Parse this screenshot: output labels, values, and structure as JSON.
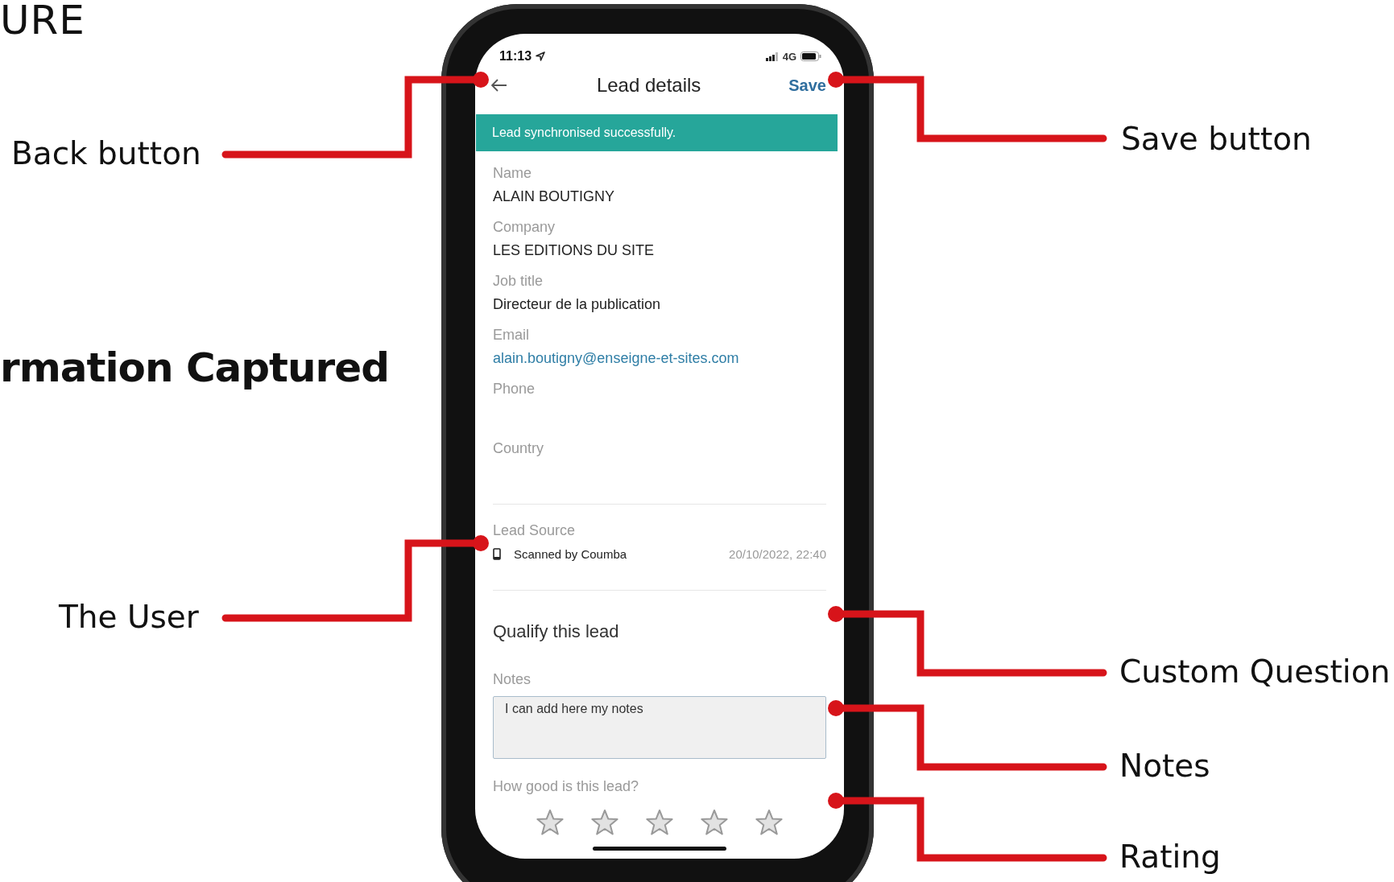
{
  "slide": {
    "heading_top": "URE",
    "heading_middle": "rmation Captured"
  },
  "annotations": [
    {
      "text": "Back button"
    },
    {
      "text": "Save button"
    },
    {
      "text": "The User"
    },
    {
      "text": "Custom Question"
    },
    {
      "text": "Notes"
    },
    {
      "text": "Rating"
    }
  ],
  "phone": {
    "status_bar": {
      "time": "11:13",
      "network": "4G"
    },
    "header": {
      "title": "Lead details",
      "save": "Save"
    },
    "banner": "Lead synchronised successfully.",
    "fields": [
      {
        "label": "Name",
        "value": "ALAIN BOUTIGNY",
        "kind": "text"
      },
      {
        "label": "Company",
        "value": "LES EDITIONS DU SITE",
        "kind": "text"
      },
      {
        "label": "Job title",
        "value": "Directeur de la publication",
        "kind": "text"
      },
      {
        "label": "Email",
        "value": "alain.boutigny@enseigne-et-sites.com",
        "kind": "link"
      },
      {
        "label": "Phone",
        "kind": "empty"
      },
      {
        "label": "Country",
        "kind": "empty"
      }
    ],
    "lead_source": {
      "label": "Lead Source",
      "source": "Scanned by Coumba",
      "date": "20/10/2022, 22:40"
    },
    "qualify": {
      "title": "Qualify this lead",
      "notes_label": "Notes",
      "notes_value": "I can add here my notes",
      "rating_question": "How good is this lead?",
      "stars": 0
    }
  }
}
